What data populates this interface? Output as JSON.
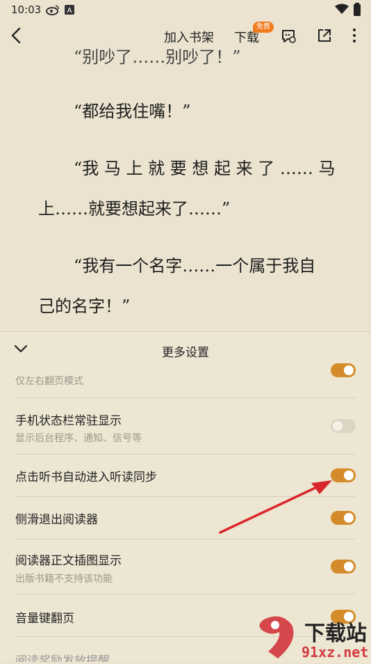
{
  "status_bar": {
    "time": "10:03",
    "icons": [
      "weibo-icon",
      "a-icon",
      "wifi-icon",
      "battery-icon"
    ]
  },
  "toolbar": {
    "add_shelf": "加入书架",
    "download": "下载",
    "free_badge": "免费"
  },
  "reader": {
    "paragraphs": [
      "“别吵了……别吵了！”",
      "“都给我住嘴！”",
      "“我 马 上 就 要 想 起 来 了 …… 马",
      "上……就要想起来了……”",
      "“我有一个名字……一个属于我自",
      "己的名字！”"
    ]
  },
  "settings": {
    "title": "更多设置",
    "rows": [
      {
        "title": "",
        "subtitle": "仅左右翻页模式",
        "on": true
      },
      {
        "title": "手机状态栏常驻显示",
        "subtitle": "显示后台程序、通知、信号等",
        "on": false
      },
      {
        "title": "点击听书自动进入听读同步",
        "subtitle": "",
        "on": true
      },
      {
        "title": "侧滑退出阅读器",
        "subtitle": "",
        "on": true
      },
      {
        "title": "阅读器正文插图显示",
        "subtitle": "出版书籍不支持该功能",
        "on": true
      },
      {
        "title": "音量键翻页",
        "subtitle": "",
        "on": true
      },
      {
        "title": "阅读奖励发放提醒",
        "subtitle": "",
        "on": true
      }
    ]
  },
  "watermark": {
    "brand": "下载站",
    "url": "91xz.net"
  },
  "colors": {
    "background": "#ebe3cf",
    "toggle_on": "#d48c2a",
    "toggle_off": "#dcd5c4",
    "arrow": "#d9262b"
  }
}
